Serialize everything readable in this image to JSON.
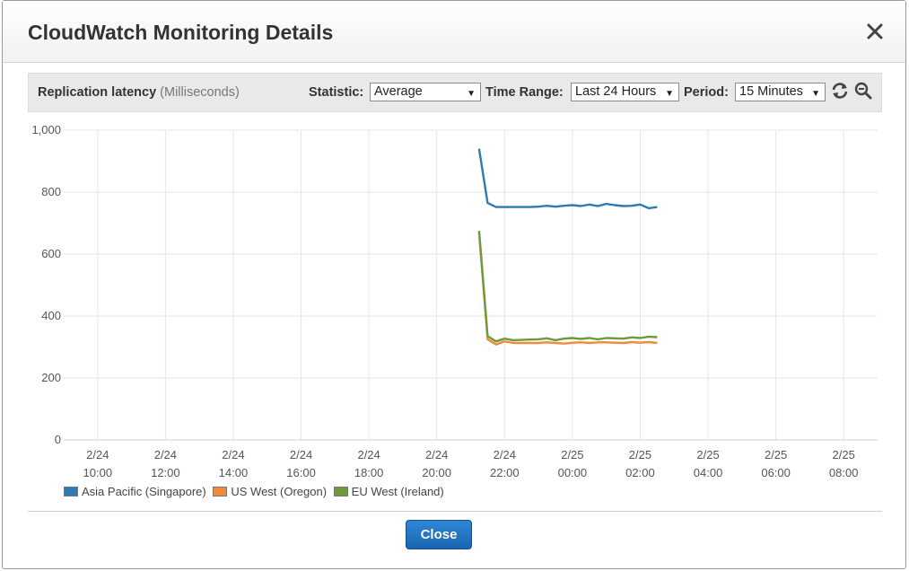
{
  "dialog": {
    "title": "CloudWatch Monitoring Details",
    "close_icon": "close-icon",
    "close_button_label": "Close"
  },
  "toolbar": {
    "metric_name": "Replication latency",
    "metric_unit": "(Milliseconds)",
    "statistic_label": "Statistic:",
    "statistic_value": "Average",
    "time_range_label": "Time Range:",
    "time_range_value": "Last 24 Hours",
    "period_label": "Period:",
    "period_value": "15 Minutes",
    "refresh_icon": "refresh-icon",
    "zoom_icon": "zoom-out-icon"
  },
  "legend": [
    {
      "name": "Asia Pacific (Singapore)",
      "color": "#2c7bb6"
    },
    {
      "name": "US West (Oregon)",
      "color": "#ef8a3a"
    },
    {
      "name": "EU West (Ireland)",
      "color": "#6e9b3a"
    }
  ],
  "chart_data": {
    "type": "line",
    "title": "",
    "xlabel": "",
    "ylabel": "",
    "ylim": [
      0,
      1000
    ],
    "yticks": [
      0,
      200,
      400,
      600,
      800,
      1000
    ],
    "ytick_labels": [
      "0",
      "200",
      "400",
      "600",
      "800",
      "1,000"
    ],
    "x_range": [
      "2/24 09:00",
      "2/25 09:00"
    ],
    "xticks": [
      {
        "date": "2/24",
        "time": "10:00"
      },
      {
        "date": "2/24",
        "time": "12:00"
      },
      {
        "date": "2/24",
        "time": "14:00"
      },
      {
        "date": "2/24",
        "time": "16:00"
      },
      {
        "date": "2/24",
        "time": "18:00"
      },
      {
        "date": "2/24",
        "time": "20:00"
      },
      {
        "date": "2/24",
        "time": "22:00"
      },
      {
        "date": "2/25",
        "time": "00:00"
      },
      {
        "date": "2/25",
        "time": "02:00"
      },
      {
        "date": "2/25",
        "time": "04:00"
      },
      {
        "date": "2/25",
        "time": "06:00"
      },
      {
        "date": "2/25",
        "time": "08:00"
      }
    ],
    "grid": true,
    "legend_position": "bottom-left",
    "series": [
      {
        "name": "Asia Pacific (Singapore)",
        "color": "#2c7bb6",
        "x": [
          "2/24 21:15",
          "2/24 21:30",
          "2/24 21:45",
          "2/24 22:00",
          "2/24 22:15",
          "2/24 22:30",
          "2/24 22:45",
          "2/24 23:00",
          "2/24 23:15",
          "2/24 23:30",
          "2/24 23:45",
          "2/25 00:00",
          "2/25 00:15",
          "2/25 00:30",
          "2/25 00:45",
          "2/25 01:00",
          "2/25 01:15",
          "2/25 01:30",
          "2/25 01:45",
          "2/25 02:00",
          "2/25 02:15",
          "2/25 02:30"
        ],
        "values": [
          940,
          765,
          752,
          752,
          752,
          752,
          752,
          753,
          756,
          753,
          756,
          758,
          755,
          760,
          755,
          762,
          758,
          755,
          756,
          760,
          748,
          752
        ]
      },
      {
        "name": "US West (Oregon)",
        "color": "#ef8a3a",
        "x": [
          "2/24 21:15",
          "2/24 21:30",
          "2/24 21:45",
          "2/24 22:00",
          "2/24 22:15",
          "2/24 22:30",
          "2/24 22:45",
          "2/24 23:00",
          "2/24 23:15",
          "2/24 23:30",
          "2/24 23:45",
          "2/25 00:00",
          "2/25 00:15",
          "2/25 00:30",
          "2/25 00:45",
          "2/25 01:00",
          "2/25 01:15",
          "2/25 01:30",
          "2/25 01:45",
          "2/25 02:00",
          "2/25 02:15",
          "2/25 02:30"
        ],
        "values": [
          670,
          325,
          308,
          318,
          313,
          313,
          313,
          313,
          315,
          313,
          311,
          314,
          315,
          313,
          315,
          315,
          314,
          313,
          316,
          314,
          316,
          313
        ]
      },
      {
        "name": "EU West (Ireland)",
        "color": "#6e9b3a",
        "x": [
          "2/24 21:15",
          "2/24 21:30",
          "2/24 21:45",
          "2/24 22:00",
          "2/24 22:15",
          "2/24 22:30",
          "2/24 22:45",
          "2/24 23:00",
          "2/24 23:15",
          "2/24 23:30",
          "2/24 23:45",
          "2/25 00:00",
          "2/25 00:15",
          "2/25 00:30",
          "2/25 00:45",
          "2/25 01:00",
          "2/25 01:15",
          "2/25 01:30",
          "2/25 01:45",
          "2/25 02:00",
          "2/25 02:15",
          "2/25 02:30"
        ],
        "values": [
          675,
          335,
          318,
          327,
          322,
          323,
          324,
          325,
          328,
          322,
          327,
          329,
          326,
          329,
          325,
          329,
          328,
          327,
          331,
          329,
          333,
          332
        ]
      }
    ]
  }
}
